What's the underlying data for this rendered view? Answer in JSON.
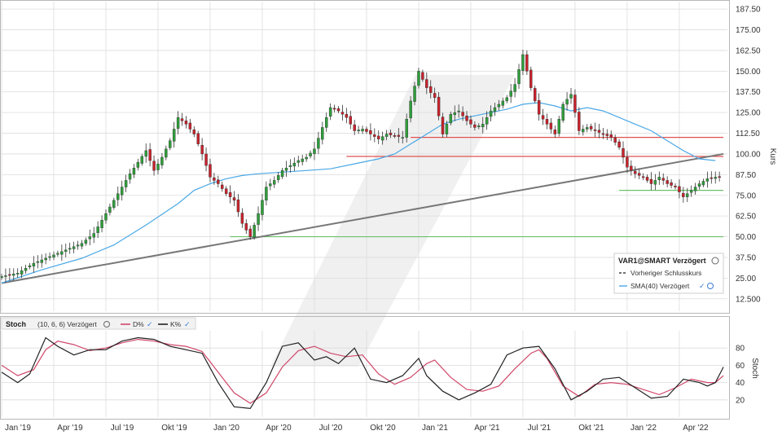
{
  "chart_data": [
    {
      "type": "candlestick",
      "y_ticks": [
        "187.50",
        "175.00",
        "162.50",
        "150.00",
        "137.50",
        "125.00",
        "112.50",
        "100.00",
        "87.50",
        "75.00",
        "62.50",
        "50.00",
        "37.50",
        "25.00",
        "12.500"
      ],
      "y_tick_values": [
        187.5,
        175,
        162.5,
        150,
        137.5,
        125,
        112.5,
        100,
        87.5,
        75,
        62.5,
        50,
        37.5,
        25,
        12.5
      ],
      "ylabel": "Kurs",
      "ylim": [
        5,
        192
      ],
      "x_tick_labels": [
        "Jan '19",
        "Apr '19",
        "Jul '19",
        "Okt '19",
        "Jan '20",
        "Apr '20",
        "Jul '20",
        "Okt '20",
        "Jan '21",
        "Apr '21",
        "Jul '21",
        "Okt '21",
        "Jan '22",
        "Apr '22"
      ],
      "x_tick_positions": [
        0,
        13,
        26,
        39,
        52,
        65,
        78,
        91,
        104,
        117,
        130,
        143,
        156,
        169
      ],
      "price_points": [
        [
          0,
          26
        ],
        [
          4,
          28
        ],
        [
          8,
          34
        ],
        [
          12,
          38
        ],
        [
          16,
          42
        ],
        [
          20,
          46
        ],
        [
          23,
          52
        ],
        [
          26,
          64
        ],
        [
          29,
          76
        ],
        [
          32,
          88
        ],
        [
          34,
          95
        ],
        [
          36,
          102
        ],
        [
          38,
          90
        ],
        [
          40,
          98
        ],
        [
          42,
          108
        ],
        [
          44,
          122
        ],
        [
          46,
          118
        ],
        [
          48,
          112
        ],
        [
          50,
          100
        ],
        [
          52,
          86
        ],
        [
          54,
          82
        ],
        [
          56,
          76
        ],
        [
          58,
          72
        ],
        [
          60,
          58
        ],
        [
          62,
          50
        ],
        [
          64,
          64
        ],
        [
          66,
          80
        ],
        [
          68,
          84
        ],
        [
          70,
          90
        ],
        [
          72,
          93
        ],
        [
          74,
          96
        ],
        [
          76,
          98
        ],
        [
          78,
          103
        ],
        [
          80,
          116
        ],
        [
          82,
          128
        ],
        [
          84,
          126
        ],
        [
          86,
          122
        ],
        [
          88,
          114
        ],
        [
          90,
          115
        ],
        [
          92,
          112
        ],
        [
          94,
          109
        ],
        [
          96,
          112
        ],
        [
          98,
          111
        ],
        [
          100,
          110
        ],
        [
          102,
          132
        ],
        [
          104,
          150
        ],
        [
          106,
          140
        ],
        [
          108,
          134
        ],
        [
          110,
          112
        ],
        [
          112,
          124
        ],
        [
          114,
          126
        ],
        [
          116,
          120
        ],
        [
          118,
          116
        ],
        [
          120,
          118
        ],
        [
          122,
          126
        ],
        [
          124,
          130
        ],
        [
          126,
          134
        ],
        [
          128,
          142
        ],
        [
          130,
          160
        ],
        [
          132,
          140
        ],
        [
          134,
          124
        ],
        [
          136,
          118
        ],
        [
          138,
          112
        ],
        [
          140,
          130
        ],
        [
          142,
          136
        ],
        [
          144,
          114
        ],
        [
          146,
          116
        ],
        [
          148,
          114
        ],
        [
          150,
          112
        ],
        [
          152,
          110
        ],
        [
          154,
          104
        ],
        [
          156,
          92
        ],
        [
          158,
          88
        ],
        [
          160,
          86
        ],
        [
          162,
          82
        ],
        [
          164,
          86
        ],
        [
          166,
          82
        ],
        [
          168,
          80
        ],
        [
          170,
          74
        ],
        [
          172,
          78
        ],
        [
          174,
          82
        ],
        [
          176,
          85
        ],
        [
          178,
          86
        ],
        [
          179,
          86
        ]
      ],
      "sma_points": [
        [
          0,
          22
        ],
        [
          10,
          30
        ],
        [
          20,
          37
        ],
        [
          28,
          45
        ],
        [
          36,
          57
        ],
        [
          44,
          70
        ],
        [
          48,
          78
        ],
        [
          52,
          82
        ],
        [
          56,
          85
        ],
        [
          60,
          87
        ],
        [
          64,
          88
        ],
        [
          70,
          89
        ],
        [
          76,
          90
        ],
        [
          82,
          91
        ],
        [
          88,
          94
        ],
        [
          94,
          97
        ],
        [
          98,
          100
        ],
        [
          102,
          106
        ],
        [
          106,
          112
        ],
        [
          110,
          118
        ],
        [
          114,
          121
        ],
        [
          118,
          123
        ],
        [
          122,
          125
        ],
        [
          126,
          127
        ],
        [
          130,
          130
        ],
        [
          134,
          131
        ],
        [
          138,
          129
        ],
        [
          142,
          126
        ],
        [
          146,
          128
        ],
        [
          150,
          126
        ],
        [
          154,
          122
        ],
        [
          158,
          118
        ],
        [
          162,
          114
        ],
        [
          166,
          108
        ],
        [
          170,
          102
        ],
        [
          174,
          97
        ],
        [
          178,
          96
        ]
      ],
      "hlines": [
        {
          "y": 110,
          "color": "#e05050",
          "x_start": 102,
          "x_end": 180
        },
        {
          "y": 98.5,
          "color": "#e05050",
          "x_start": 86,
          "x_end": 180
        },
        {
          "y": 78,
          "color": "#6cc16c",
          "x_start": 154,
          "x_end": 180
        },
        {
          "y": 50,
          "color": "#6cc16c",
          "x_start": 57,
          "x_end": 180
        }
      ],
      "trendline": {
        "x0": 0,
        "y0": 22,
        "x1": 180,
        "y1": 100,
        "color": "#777777"
      },
      "legend": {
        "title": "VAR1@SMART Verzögert",
        "items": [
          {
            "label": "Vorheriger Schlusskurs",
            "color": "#444444"
          },
          {
            "label": "SMA(40) Verzögert",
            "color": "#4aa8e6"
          }
        ]
      },
      "colors": {
        "up": "#2e9e3a",
        "down": "#c8222c",
        "sma": "#4aa8e6",
        "grid": "#dcdcdc"
      }
    },
    {
      "type": "line",
      "title": "Stoch",
      "subtitle": "(10, 6, 6) Verzögert",
      "ylabel": "Stoch",
      "y_ticks": [
        "80",
        "60",
        "40",
        "20"
      ],
      "y_tick_values": [
        80,
        60,
        40,
        20
      ],
      "ylim": [
        0,
        100
      ],
      "series": [
        {
          "name": "D%",
          "color": "#d0486a",
          "points": [
            [
              0,
              60
            ],
            [
              4,
              48
            ],
            [
              8,
              55
            ],
            [
              11,
              78
            ],
            [
              14,
              88
            ],
            [
              18,
              84
            ],
            [
              22,
              77
            ],
            [
              26,
              80
            ],
            [
              30,
              86
            ],
            [
              34,
              90
            ],
            [
              38,
              88
            ],
            [
              42,
              84
            ],
            [
              46,
              82
            ],
            [
              50,
              76
            ],
            [
              54,
              52
            ],
            [
              58,
              28
            ],
            [
              62,
              16
            ],
            [
              66,
              28
            ],
            [
              70,
              58
            ],
            [
              74,
              77
            ],
            [
              78,
              82
            ],
            [
              82,
              74
            ],
            [
              86,
              70
            ],
            [
              90,
              72
            ],
            [
              94,
              50
            ],
            [
              98,
              38
            ],
            [
              102,
              46
            ],
            [
              106,
              62
            ],
            [
              108,
              66
            ],
            [
              112,
              46
            ],
            [
              116,
              32
            ],
            [
              120,
              30
            ],
            [
              124,
              36
            ],
            [
              128,
              56
            ],
            [
              132,
              74
            ],
            [
              134,
              78
            ],
            [
              136,
              68
            ],
            [
              140,
              36
            ],
            [
              144,
              24
            ],
            [
              148,
              38
            ],
            [
              152,
              40
            ],
            [
              156,
              38
            ],
            [
              160,
              32
            ],
            [
              164,
              26
            ],
            [
              168,
              34
            ],
            [
              172,
              44
            ],
            [
              176,
              40
            ],
            [
              178,
              40
            ],
            [
              180,
              48
            ]
          ]
        },
        {
          "name": "K%",
          "color": "#222222",
          "points": [
            [
              0,
              52
            ],
            [
              4,
              40
            ],
            [
              7,
              50
            ],
            [
              11,
              92
            ],
            [
              14,
              82
            ],
            [
              18,
              72
            ],
            [
              22,
              78
            ],
            [
              26,
              78
            ],
            [
              30,
              88
            ],
            [
              34,
              92
            ],
            [
              38,
              90
            ],
            [
              42,
              82
            ],
            [
              46,
              78
            ],
            [
              50,
              74
            ],
            [
              54,
              40
            ],
            [
              58,
              12
            ],
            [
              62,
              10
            ],
            [
              66,
              40
            ],
            [
              70,
              82
            ],
            [
              74,
              86
            ],
            [
              78,
              66
            ],
            [
              81,
              70
            ],
            [
              84,
              62
            ],
            [
              88,
              80
            ],
            [
              92,
              44
            ],
            [
              96,
              40
            ],
            [
              100,
              48
            ],
            [
              104,
              68
            ],
            [
              106,
              48
            ],
            [
              110,
              30
            ],
            [
              114,
              20
            ],
            [
              118,
              28
            ],
            [
              122,
              38
            ],
            [
              126,
              72
            ],
            [
              130,
              80
            ],
            [
              134,
              82
            ],
            [
              138,
              56
            ],
            [
              142,
              20
            ],
            [
              146,
              30
            ],
            [
              150,
              44
            ],
            [
              154,
              46
            ],
            [
              158,
              34
            ],
            [
              162,
              22
            ],
            [
              166,
              24
            ],
            [
              170,
              44
            ],
            [
              174,
              40
            ],
            [
              176,
              36
            ],
            [
              178,
              40
            ],
            [
              180,
              58
            ]
          ]
        }
      ],
      "legend_labels": {
        "d": "D%",
        "k": "K%"
      }
    }
  ]
}
